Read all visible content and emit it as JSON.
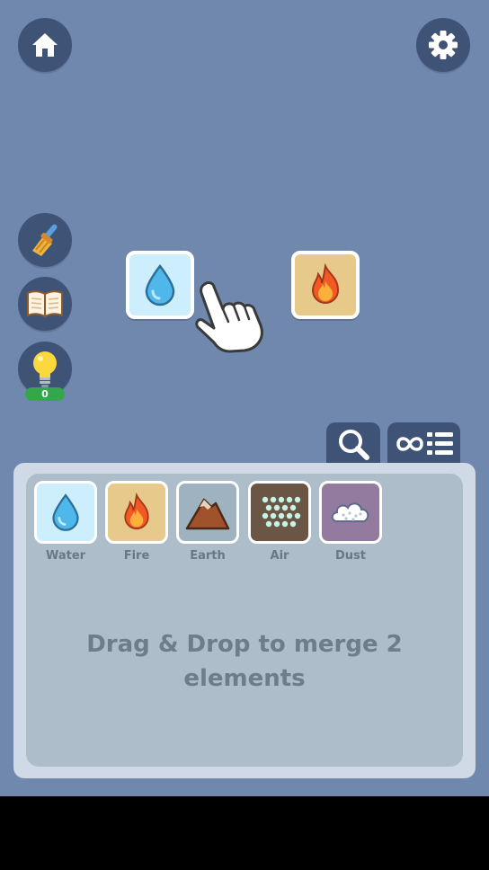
{
  "toolbar": {
    "home_icon": "home-icon",
    "settings_icon": "gear-icon"
  },
  "side_tools": {
    "clean_icon": "broom-icon",
    "book_icon": "book-icon",
    "hint_icon": "lightbulb-icon",
    "hint_count": "0"
  },
  "board": {
    "tiles": [
      {
        "element": "water",
        "icon": "water-drop-icon",
        "bg": "#cdeefd"
      },
      {
        "element": "fire",
        "icon": "fire-icon",
        "bg": "#e8c98c"
      }
    ],
    "pointer_icon": "hand-pointer-icon"
  },
  "tabs": {
    "search_icon": "search-icon",
    "list_icon": "infinity-list-icon"
  },
  "inventory": {
    "elements": [
      {
        "label": "Water",
        "icon": "water-drop-icon",
        "bg": "#cdeefd"
      },
      {
        "label": "Fire",
        "icon": "fire-icon",
        "bg": "#e8c98c"
      },
      {
        "label": "Earth",
        "icon": "mountain-icon",
        "bg": "#9fb2bf"
      },
      {
        "label": "Air",
        "icon": "air-dots-icon",
        "bg": "#6b5545"
      },
      {
        "label": "Dust",
        "icon": "dust-cloud-icon",
        "bg": "#927b9f"
      }
    ],
    "hint_text": "Drag & Drop to merge 2 elements"
  },
  "colors": {
    "background": "#7088ae",
    "button": "#3f5377",
    "panel": "#aebdca",
    "badge": "#36a64a"
  }
}
